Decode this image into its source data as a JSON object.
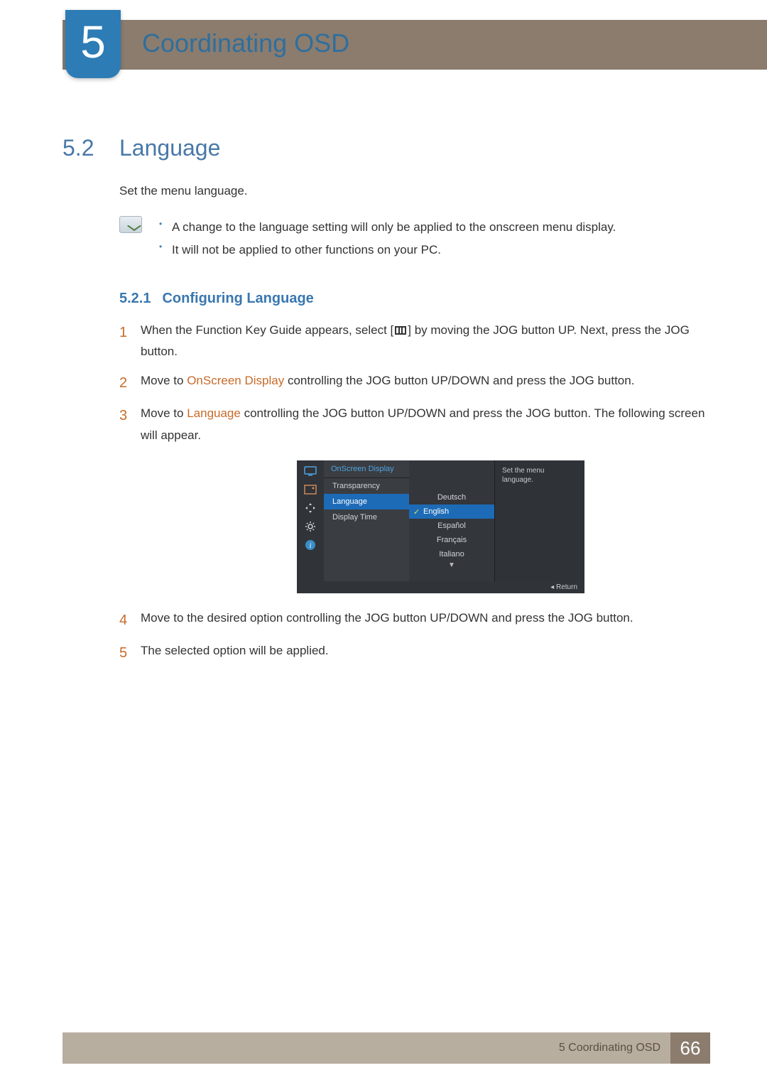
{
  "chapter": {
    "num": "5",
    "title": "Coordinating OSD"
  },
  "section": {
    "num": "5.2",
    "title": "Language",
    "intro": "Set the menu language."
  },
  "notes": [
    "A change to the language setting will only be applied to the onscreen menu display.",
    "It will not be applied to other functions on your PC."
  ],
  "subsection": {
    "num": "5.2.1",
    "title": "Configuring Language"
  },
  "steps": {
    "s1a": "When the Function Key Guide appears, select [",
    "s1b": "] by moving the JOG button UP. Next, press the JOG button.",
    "s2a": "Move to ",
    "s2hl": "OnScreen Display",
    "s2b": " controlling the JOG button UP/DOWN and press the JOG button.",
    "s3a": "Move to ",
    "s3hl": "Language",
    "s3b": " controlling the JOG button UP/DOWN and press the JOG button. The following screen will appear.",
    "s4": "Move to the desired option controlling the JOG button UP/DOWN and press the JOG button.",
    "s5": "The selected option will be applied."
  },
  "step_nums": {
    "n1": "1",
    "n2": "2",
    "n3": "3",
    "n4": "4",
    "n5": "5"
  },
  "osd": {
    "header": "OnScreen Display",
    "menu": [
      "Transparency",
      "Language",
      "Display Time"
    ],
    "selected_menu": "Language",
    "options": [
      "Deutsch",
      "English",
      "Español",
      "Français",
      "Italiano"
    ],
    "active_option": "English",
    "info": "Set the menu language.",
    "return": "Return"
  },
  "footer": {
    "label": "5 Coordinating OSD",
    "page": "66"
  }
}
